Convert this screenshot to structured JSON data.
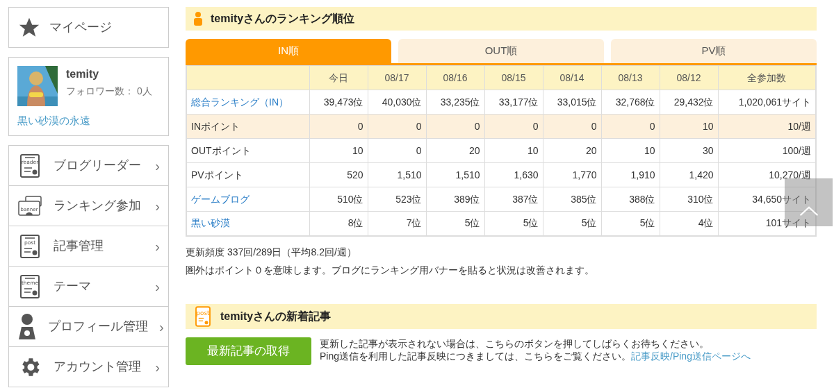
{
  "sidebar": {
    "mypage": {
      "label": "マイページ"
    },
    "profile": {
      "name": "temity",
      "followers": "フォロワー数： 0人",
      "blog": "黒い砂漠の永遠"
    },
    "menu": [
      {
        "label": "ブログリーダー",
        "icon_text": "reader",
        "chevron": "›"
      },
      {
        "label": "ランキング参加",
        "icon_text": "banner",
        "chevron": "›"
      },
      {
        "label": "記事管理",
        "icon_text": "post",
        "chevron": "›"
      },
      {
        "label": "テーマ",
        "icon_text": "theme",
        "chevron": "›"
      },
      {
        "label": "プロフィール管理",
        "chevron": "›"
      },
      {
        "label": "アカウント管理",
        "chevron": "›"
      }
    ]
  },
  "ranking": {
    "title": "temityさんのランキング順位",
    "tabs": [
      {
        "label": "IN順",
        "selected": true
      },
      {
        "label": "OUT順",
        "selected": false
      },
      {
        "label": "PV順",
        "selected": false
      }
    ],
    "table": {
      "columns": [
        "今日",
        "08/17",
        "08/16",
        "08/15",
        "08/14",
        "08/13",
        "08/12",
        "全参加数"
      ],
      "rows": [
        {
          "label": "総合ランキング（IN）",
          "kind": "link",
          "tinted": false,
          "cells": [
            "39,473位",
            "40,030位",
            "33,235位",
            "33,177位",
            "33,015位",
            "32,768位",
            "29,432位",
            "1,020,061サイト"
          ]
        },
        {
          "label": "INポイント",
          "kind": "text",
          "tinted": true,
          "cells": [
            "0",
            "0",
            "0",
            "0",
            "0",
            "0",
            "10",
            "10/週"
          ]
        },
        {
          "label": "OUTポイント",
          "kind": "text",
          "tinted": false,
          "cells": [
            "10",
            "0",
            "20",
            "10",
            "20",
            "10",
            "30",
            "100/週"
          ]
        },
        {
          "label": "PVポイント",
          "kind": "text",
          "tinted": false,
          "cells": [
            "520",
            "1,510",
            "1,510",
            "1,630",
            "1,770",
            "1,910",
            "1,420",
            "10,270/週"
          ]
        },
        {
          "label": "ゲームブログ",
          "kind": "link",
          "tinted": false,
          "cells": [
            "510位",
            "523位",
            "389位",
            "387位",
            "385位",
            "388位",
            "310位",
            "34,650サイト"
          ]
        },
        {
          "label": "黒い砂漠",
          "kind": "link",
          "tinted": false,
          "cells": [
            "8位",
            "7位",
            "5位",
            "5位",
            "5位",
            "5位",
            "4位",
            "101サイト"
          ]
        }
      ]
    },
    "frequency": "更新頻度 337回/289日（平均8.2回/週）",
    "note": "圏外はポイント０を意味します。ブログにランキング用バナーを貼ると状況は改善されます。"
  },
  "articles": {
    "title": "temityさんの新着記事",
    "icon_text": "post",
    "button": "最新記事の取得",
    "line1": "更新した記事が表示されない場合は、こちらのボタンを押してしばらくお待ちください。",
    "line2": "Ping送信を利用した記事反映につきましては、こちらをご覧ください。",
    "link": "記事反映/Ping送信ページへ"
  }
}
